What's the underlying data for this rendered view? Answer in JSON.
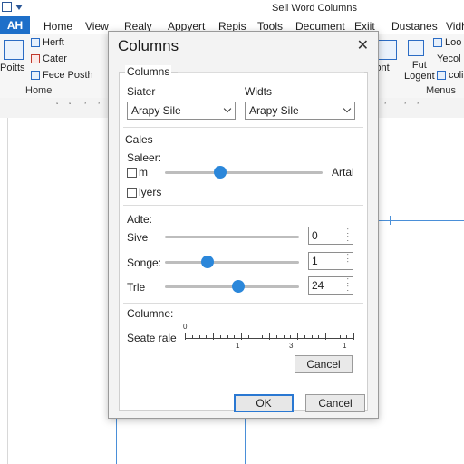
{
  "app": {
    "window_title": "Seil Word Columns",
    "file_tab": "AH",
    "menu": [
      "Home",
      "View",
      "Realy",
      "Appyert",
      "Repis",
      "Tools",
      "Decument",
      "Exiit",
      "Dustanes",
      "Vidh"
    ],
    "ribbon": {
      "left_items": [
        "Herft",
        "Cater",
        "Fece Posth"
      ],
      "left_big_label": "Poitts",
      "left_group": "Home",
      "right_items": [
        "Loo",
        "Yecol",
        "coli"
      ],
      "right_big_labels": [
        "Fut\nLogent",
        "iont"
      ],
      "right_group": "Menus"
    }
  },
  "dialog": {
    "title": "Columns",
    "section_columns": "Columns",
    "col1_label": "Siater",
    "col2_label": "Widts",
    "col1_select": "Arapy Sile",
    "col2_select": "Arapy Sile",
    "section_cales": "Cales",
    "saleer_label": "Saleer:",
    "check1_label": "m",
    "slider_end_label": "Artal",
    "check2_label": "lyers",
    "adte_label": "Adte:",
    "rows": [
      {
        "label": "Sive",
        "value": "0",
        "level": null
      },
      {
        "label": "Songe:",
        "value": "1",
        "level": 0.32
      },
      {
        "label": "Trle",
        "value": "24",
        "level": 0.55
      }
    ],
    "top_slider_level": 0.35,
    "columne_label": "Columne:",
    "scale_label": "Seate rale",
    "scale_ticks": [
      "0",
      "1",
      "3",
      "1"
    ],
    "inner_cancel": "Cancel",
    "ok": "OK",
    "cancel": "Cancel"
  }
}
